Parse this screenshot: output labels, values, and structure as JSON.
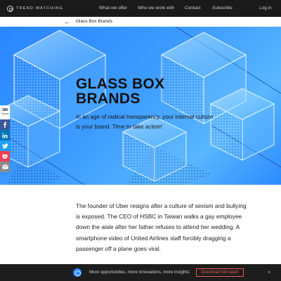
{
  "nav": {
    "logo_text": "TREND·WATCHING",
    "links": [
      "What we offer",
      "Who we work with",
      "Contact",
      "Subscribe"
    ],
    "login": "Log in"
  },
  "breadcrumb": {
    "label": "Glass Box Brands"
  },
  "hero": {
    "title_line1": "GLASS BOX",
    "title_line2": "BRANDS",
    "subtitle": "In an age of radical transparency, your internal culture is your brand. Time to take action!"
  },
  "share": {
    "count": "389",
    "count_label": "Shares",
    "buttons": [
      {
        "icon": "facebook-icon",
        "color": "#3b5998"
      },
      {
        "icon": "linkedin-icon",
        "color": "#0077b5"
      },
      {
        "icon": "twitter-icon",
        "color": "#1da1f2"
      },
      {
        "icon": "pocket-icon",
        "color": "#ef4056"
      },
      {
        "icon": "email-icon",
        "color": "#8a8a8a"
      }
    ]
  },
  "article": {
    "paragraph": "The founder of Uber resigns after a culture of sexism and bullying is exposed. The CEO of HSBC in Taiwan walks a gay employee down the aisle after her father refuses to attend her wedding. A smartphone video of United Airlines staff forcibly dragging a passenger off a plane goes viral."
  },
  "banner": {
    "text": "More opportunities, more innovations, more insights:",
    "button": "Download full report",
    "close": "×"
  }
}
